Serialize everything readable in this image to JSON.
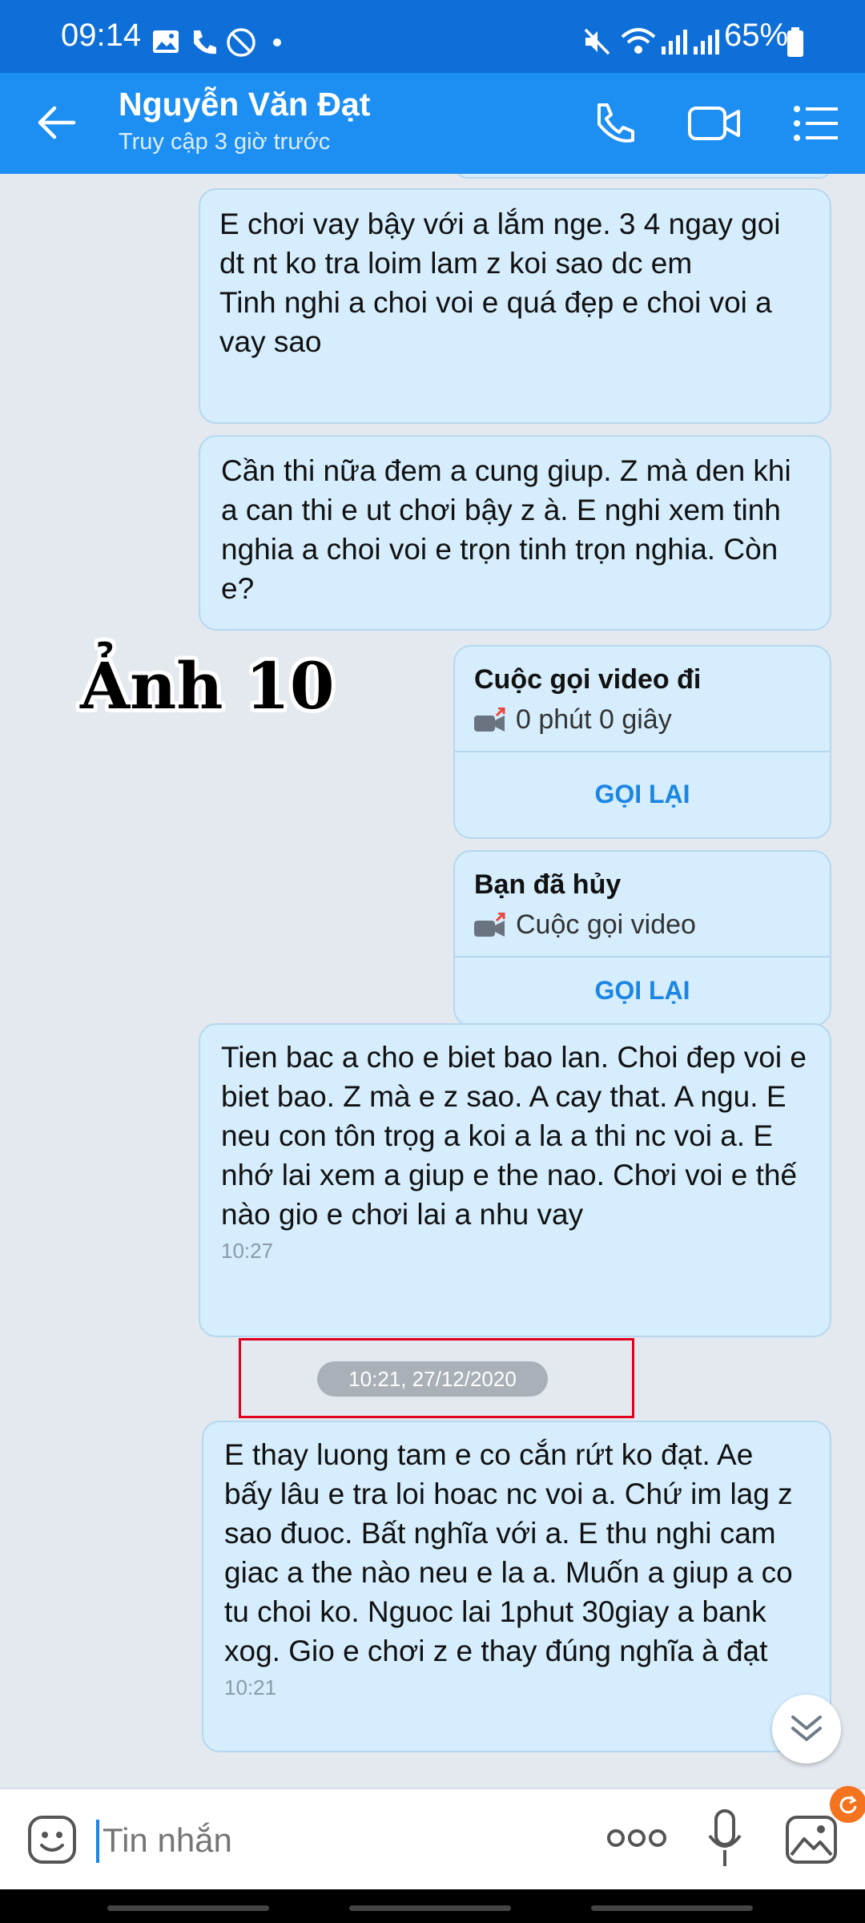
{
  "status_bar": {
    "time": "09:14",
    "battery": "65%",
    "icons": [
      "gallery-icon",
      "wifi-call-icon",
      "dnd-icon",
      "mute-icon",
      "wifi-icon",
      "signal-icon",
      "battery-icon"
    ]
  },
  "header": {
    "contact_name": "Nguyễn Văn Đạt",
    "subtitle": "Truy cập 3 giờ trước"
  },
  "overlay_label": "Ảnh 10",
  "messages": [
    {
      "text": "E chơi vay bậy với a lắm nge. 3 4 ngay goi dt nt ko tra loim lam z koi sao dc em\nTinh nghi a choi voi e quá đẹp e choi voi a vay sao"
    },
    {
      "text": "Cần thi nữa đem a cung giup. Z mà den khi a can thi e ut chơi bậy z à. E nghi xem tinh nghia a choi voi e trọn tinh trọn nghia. Còn e?"
    },
    {
      "text": "Tien bac a cho e biet bao lan. Choi đep voi e biet bao. Z mà e z sao. A cay that. A ngu. E neu con tôn trọg a koi a la a thi nc voi a. E nhớ lai xem a giup e the nao. Chơi voi e thế nào gio e chơi lai a nhu vay",
      "time": "10:27"
    },
    {
      "text": "E thay luong tam e co cắn rứt ko đạt. Ae bấy lâu e tra loi hoac nc voi a. Chứ im lag z sao đuoc. Bất nghĩa với a. E thu nghi cam giac a the nào neu e la a. Muốn a giup a co tu choi ko. Nguoc lai 1phut 30giay a bank xog. Gio e chơi z e thay đúng nghĩa à đạt",
      "time": "10:21"
    }
  ],
  "calls": [
    {
      "title": "Cuộc gọi video đi",
      "detail": "0 phút 0 giây",
      "action": "GỌI LẠI"
    },
    {
      "title": "Bạn đã hủy",
      "detail": "Cuộc gọi video",
      "action": "GỌI LẠI"
    }
  ],
  "date_separator": "10:21, 27/12/2020",
  "composer": {
    "placeholder": "Tin nhắn"
  },
  "colors": {
    "header": "#1e8ff2",
    "statusbar": "#0f6fd9",
    "bubble": "#d5edfd",
    "accent": "#1b86e3",
    "highlight_box": "#e0001b"
  }
}
